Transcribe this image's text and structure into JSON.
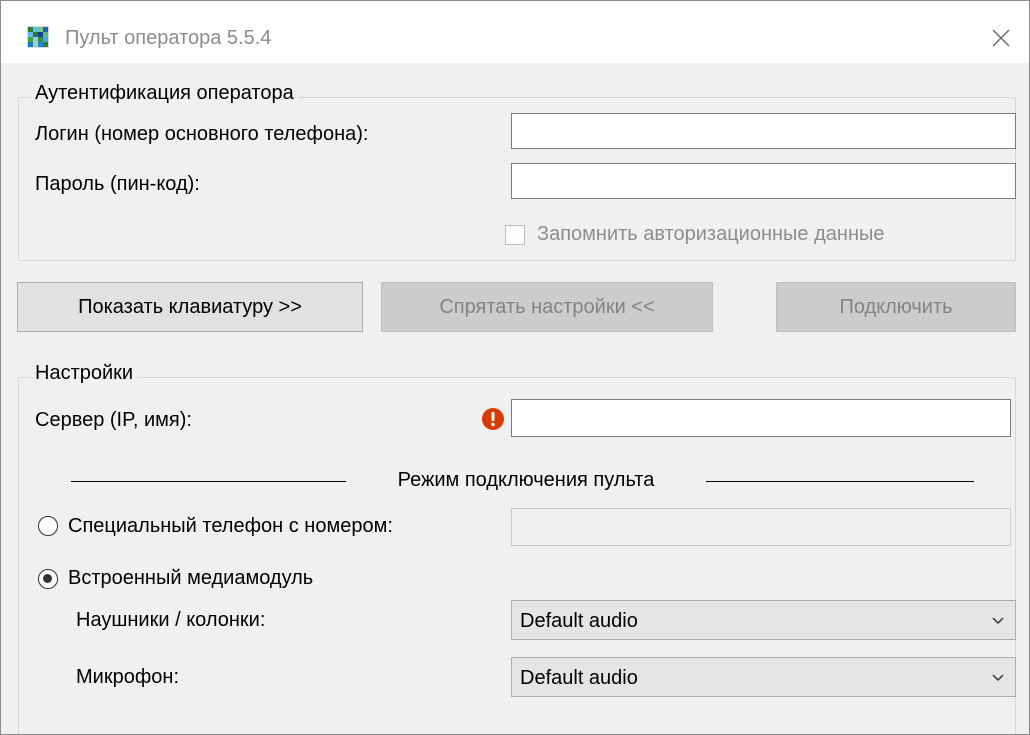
{
  "window": {
    "title": "Пульт оператора 5.5.4"
  },
  "auth": {
    "legend": "Аутентификация оператора",
    "login_label": "Логин (номер основного телефона):",
    "login_value": "",
    "password_label": "Пароль (пин-код):",
    "password_value": "",
    "remember_label": "Запомнить авторизационные данные",
    "remember_checked": false
  },
  "buttons": {
    "show_keyboard": "Показать клавиатуру >>",
    "hide_settings": "Спрятать настройки <<",
    "connect": "Подключить"
  },
  "settings": {
    "legend": "Настройки",
    "server_label": "Сервер (IP, имя):",
    "server_value": "",
    "mode_title": "Режим подключения пульта",
    "special_phone_label": "Специальный телефон с номером:",
    "special_phone_value": "",
    "builtin_label": "Встроенный медиамодуль",
    "selected_mode": "builtin",
    "headphones_label": "Наушники / колонки:",
    "headphones_value": "Default audio",
    "mic_label": "Микрофон:",
    "mic_value": "Default audio"
  },
  "icons": {
    "app": "grid-app-icon",
    "close": "close-icon",
    "error": "error-icon",
    "dropdown": "chevron-down-icon"
  },
  "colors": {
    "window_bg": "#f0f0f0",
    "error_red": "#d83b01",
    "disabled_button": "#cccccc"
  }
}
